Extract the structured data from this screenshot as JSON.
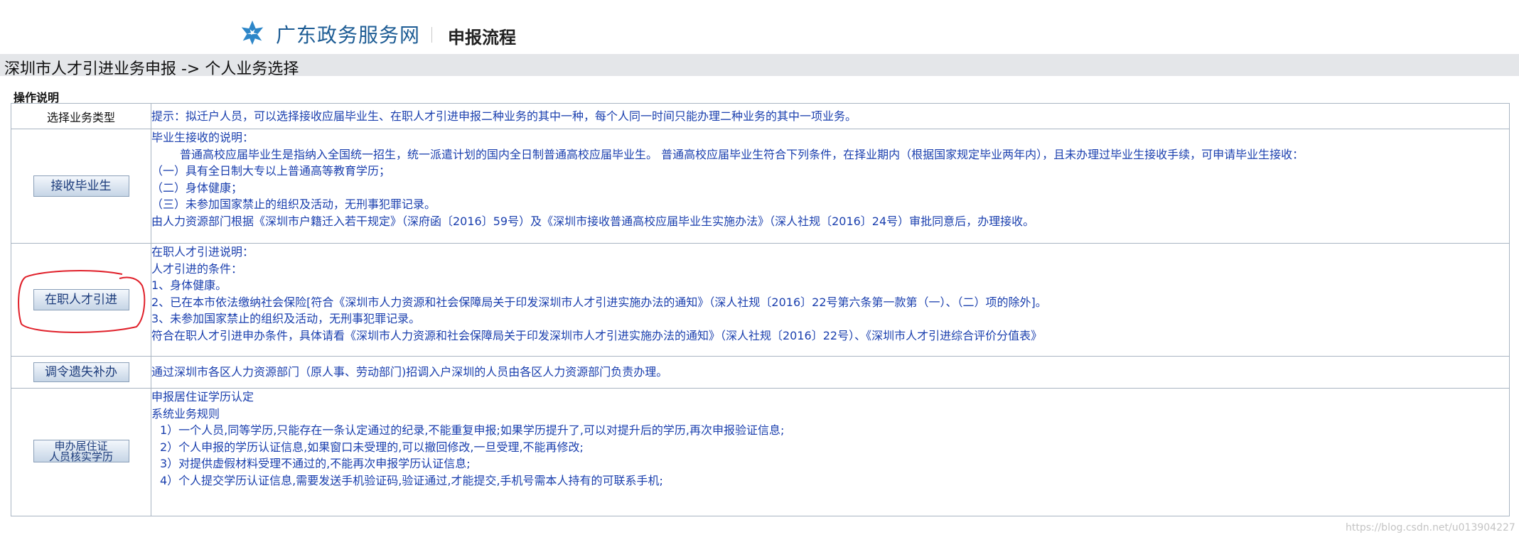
{
  "header": {
    "site_name": "广东政务服务网",
    "flow_title": "申报流程"
  },
  "breadcrumb": "深圳市人才引进业务申报 -> 个人业务选择",
  "op_title": "操作说明",
  "table": {
    "header_label": "选择业务类型",
    "header_tip": "提示：拟迁户人员，可以选择接收应届毕业生、在职人才引进申报二种业务的其中一种，每个人同一时间只能办理二种业务的其中一项业务。",
    "rows": [
      {
        "button": "接收毕业生",
        "lines": [
          "毕业生接收的说明：",
          "普通高校应届毕业生是指纳入全国统一招生，统一派遣计划的国内全日制普通高校应届毕业生。 普通高校应届毕业生符合下列条件，在择业期内（根据国家规定毕业两年内），且未办理过毕业生接收手续，可申请毕业生接收：",
          "（一）具有全日制大专以上普通高等教育学历；",
          "（二）身体健康；",
          "（三）未参加国家禁止的组织及活动，无刑事犯罪记录。",
          "由人力资源部门根据《深圳市户籍迁入若干规定》（深府函〔2016〕59号）及《深圳市接收普通高校应届毕业生实施办法》（深人社规〔2016〕24号）审批同意后，办理接收。"
        ]
      },
      {
        "button": "在职人才引进",
        "lines": [
          "在职人才引进说明：",
          "人才引进的条件：",
          "1、身体健康。",
          "2、已在本市依法缴纳社会保险[符合《深圳市人力资源和社会保障局关于印发深圳市人才引进实施办法的通知》（深人社规〔2016〕22号第六条第一款第（一）、（二）项的除外]。",
          "3、未参加国家禁止的组织及活动，无刑事犯罪记录。",
          "符合在职人才引进申办条件，具体请看《深圳市人力资源和社会保障局关于印发深圳市人才引进实施办法的通知》（深人社规〔2016〕22号）、《深圳市人才引进综合评价分值表》"
        ]
      },
      {
        "button": "调令遗失补办",
        "lines": [
          "通过深圳市各区人力资源部门（原人事、劳动部门)招调入户深圳的人员由各区人力资源部门负责办理。"
        ]
      },
      {
        "button_line1": "申办居住证",
        "button_line2": "人员核实学历",
        "lines": [
          "申报居住证学历认定",
          "系统业务规则",
          "1）一个人员,同等学历,只能存在一条认定通过的纪录,不能重复申报;如果学历提升了,可以对提升后的学历,再次申报验证信息;",
          "2）个人申报的学历认证信息,如果窗口未受理的,可以撤回修改,一旦受理,不能再修改;",
          "3）对提供虚假材料受理不通过的,不能再次申报学历认证信息;",
          "4）个人提交学历认证信息,需要发送手机验证码,验证通过,才能提交,手机号需本人持有的可联系手机;"
        ]
      }
    ]
  },
  "watermark": "https://blog.csdn.net/u013904227",
  "colors": {
    "link_text": "#1a3fae",
    "site_blue": "#1d5c94",
    "annotation_red": "#e0202a",
    "breadcrumb_bg": "#e4e6e9"
  }
}
